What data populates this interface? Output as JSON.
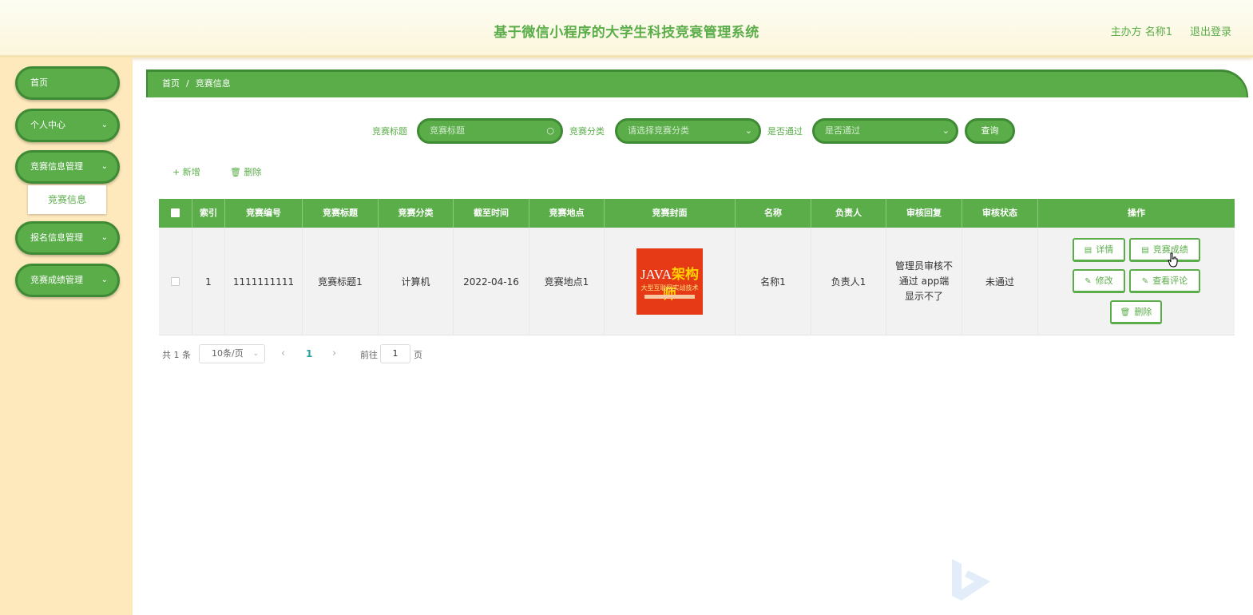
{
  "header": {
    "title": "基于微信小程序的大学生科技竞衰管理系统",
    "user_label": "主办方 名称1",
    "logout_label": "退出登录"
  },
  "sidebar": {
    "items": [
      {
        "label": "首页"
      },
      {
        "label": "个人中心",
        "chevron": "⌄"
      },
      {
        "label": "竞赛信息管理",
        "chevron": "⌄"
      },
      {
        "label": "报名信息管理",
        "chevron": "⌄"
      },
      {
        "label": "竞赛成绩管理",
        "chevron": "⌄"
      }
    ],
    "submenu_item": "竞赛信息"
  },
  "breadcrumb": {
    "home": "首页",
    "sep": "/",
    "current": "竞赛信息"
  },
  "search": {
    "title_label": "竞赛标题",
    "title_placeholder": "竞赛标题",
    "category_label": "竞赛分类",
    "category_placeholder": "请选择竞赛分类",
    "passed_label": "是否通过",
    "passed_placeholder": "是否通过",
    "query_label": "查询"
  },
  "toolbar": {
    "add_label": "新增",
    "delete_label": "删除"
  },
  "table": {
    "headers": [
      "索引",
      "竞赛编号",
      "竞赛标题",
      "竞赛分类",
      "截至时间",
      "竞赛地点",
      "竞赛封面",
      "名称",
      "负责人",
      "审核回复",
      "审核状态",
      "操作"
    ],
    "rows": [
      {
        "index": "1",
        "code": "1111111111",
        "title": "竞赛标题1",
        "category": "计算机",
        "deadline": "2022-04-16",
        "location": "竞赛地点1",
        "cover": {
          "java": "JAVA",
          "arch": "架构师",
          "subtitle": "大型互联网实战技术"
        },
        "name": "名称1",
        "manager": "负责人1",
        "review_reply": "管理员审核不通过 app端显示不了",
        "review_status": "未通过"
      }
    ],
    "actions": {
      "detail": "详情",
      "scores": "竞赛成绩",
      "edit": "修改",
      "comments": "查看评论",
      "delete": "删除"
    }
  },
  "pagination": {
    "total": "共 1 条",
    "page_size": "10条/页",
    "current_page": "1",
    "goto_label": "前往",
    "goto_value": "1",
    "page_suffix": "页"
  },
  "colors": {
    "accent": "#5aad49",
    "accent_dark": "#3f8a34",
    "sidebar_bg": "#fde9bb"
  }
}
